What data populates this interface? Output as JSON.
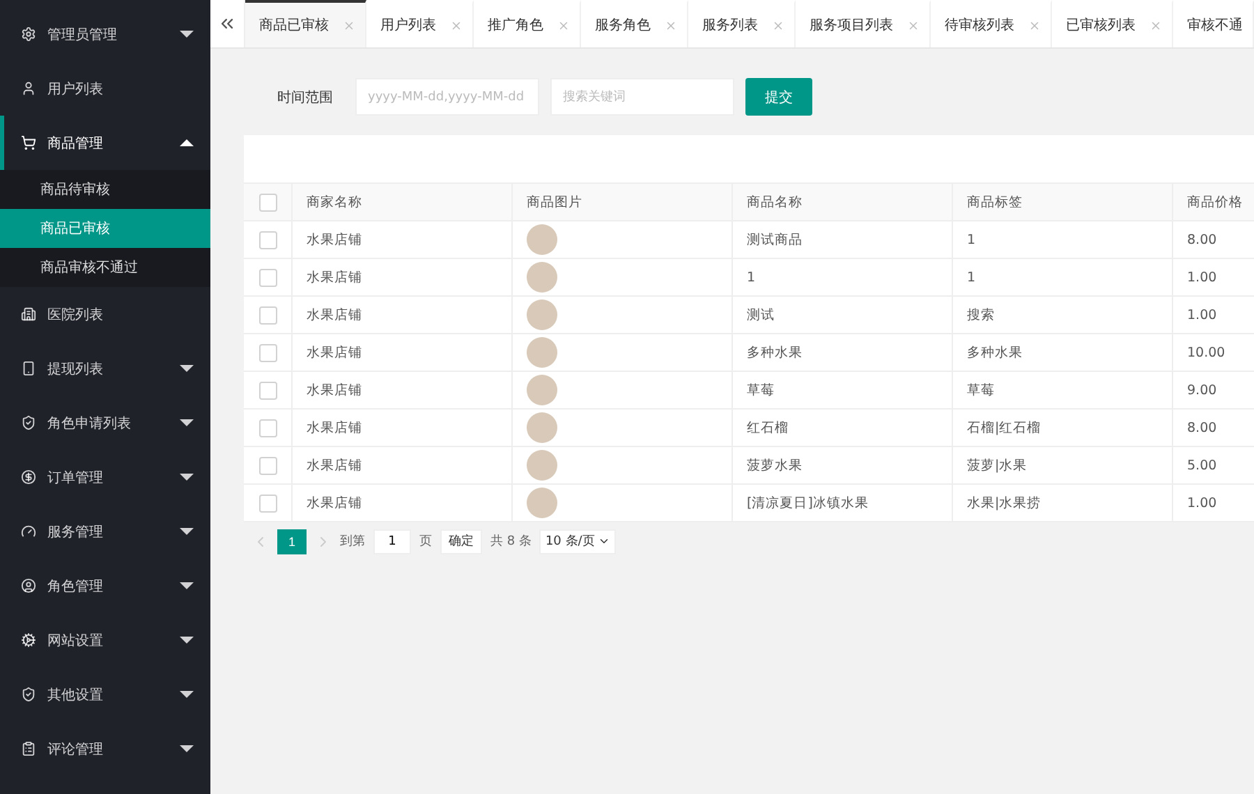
{
  "sidebar": {
    "items": [
      {
        "label": "管理员管理",
        "kind": "group",
        "expanded": false,
        "selected": false
      },
      {
        "label": "用户列表",
        "kind": "link",
        "selected": false
      },
      {
        "label": "商品管理",
        "kind": "group",
        "expanded": true,
        "selected": true,
        "children": [
          {
            "label": "商品待审核",
            "selected": false
          },
          {
            "label": "商品已审核",
            "selected": true
          },
          {
            "label": "商品审核不通过",
            "selected": false
          }
        ]
      },
      {
        "label": "医院列表",
        "kind": "link",
        "selected": false
      },
      {
        "label": "提现列表",
        "kind": "group",
        "expanded": false,
        "selected": false
      },
      {
        "label": "角色申请列表",
        "kind": "group",
        "expanded": false,
        "selected": false
      },
      {
        "label": "订单管理",
        "kind": "group",
        "expanded": false,
        "selected": false
      },
      {
        "label": "服务管理",
        "kind": "group",
        "expanded": false,
        "selected": false
      },
      {
        "label": "角色管理",
        "kind": "group",
        "expanded": false,
        "selected": false
      },
      {
        "label": "网站设置",
        "kind": "group",
        "expanded": false,
        "selected": false
      },
      {
        "label": "其他设置",
        "kind": "group",
        "expanded": false,
        "selected": false
      },
      {
        "label": "评论管理",
        "kind": "group",
        "expanded": false,
        "selected": false
      }
    ]
  },
  "tabs": [
    {
      "label": "商品已审核",
      "selected": true,
      "closable": true
    },
    {
      "label": "用户列表",
      "selected": false,
      "closable": true
    },
    {
      "label": "推广角色",
      "selected": false,
      "closable": true
    },
    {
      "label": "服务角色",
      "selected": false,
      "closable": true
    },
    {
      "label": "服务列表",
      "selected": false,
      "closable": true
    },
    {
      "label": "服务项目列表",
      "selected": false,
      "closable": true
    },
    {
      "label": "待审核列表",
      "selected": false,
      "closable": true
    },
    {
      "label": "已审核列表",
      "selected": false,
      "closable": true
    },
    {
      "label": "审核不通",
      "selected": false,
      "closable": false
    }
  ],
  "filter": {
    "label": "时间范围",
    "date_placeholder": "yyyy-MM-dd,yyyy-MM-dd",
    "search_placeholder": "搜索关键词",
    "submit": "提交"
  },
  "table": {
    "all_checked": false,
    "columns": [
      "商家名称",
      "商品图片",
      "商品名称",
      "商品标签",
      "商品价格"
    ],
    "rows": [
      {
        "checked": false,
        "shop": "水果店铺",
        "name": "测试商品",
        "tag": "1",
        "price": "8.00"
      },
      {
        "checked": false,
        "shop": "水果店铺",
        "name": "1",
        "tag": "1",
        "price": "1.00"
      },
      {
        "checked": false,
        "shop": "水果店铺",
        "name": "测试",
        "tag": "搜索",
        "price": "1.00"
      },
      {
        "checked": false,
        "shop": "水果店铺",
        "name": "多种水果",
        "tag": "多种水果",
        "price": "10.00"
      },
      {
        "checked": false,
        "shop": "水果店铺",
        "name": "草莓",
        "tag": "草莓",
        "price": "9.00"
      },
      {
        "checked": false,
        "shop": "水果店铺",
        "name": "红石榴",
        "tag": "石榴|红石榴",
        "price": "8.00"
      },
      {
        "checked": false,
        "shop": "水果店铺",
        "name": "菠萝水果",
        "tag": "菠萝|水果",
        "price": "5.00"
      },
      {
        "checked": false,
        "shop": "水果店铺",
        "name": "[清凉夏日]冰镇水果",
        "tag": "水果|水果捞",
        "price": "1.00"
      }
    ]
  },
  "pagination": {
    "current": "1",
    "goto_label": "到第",
    "goto_value": "1",
    "page_label": "页",
    "confirm": "确定",
    "total": "共 8 条",
    "page_size": "10 条/页"
  }
}
